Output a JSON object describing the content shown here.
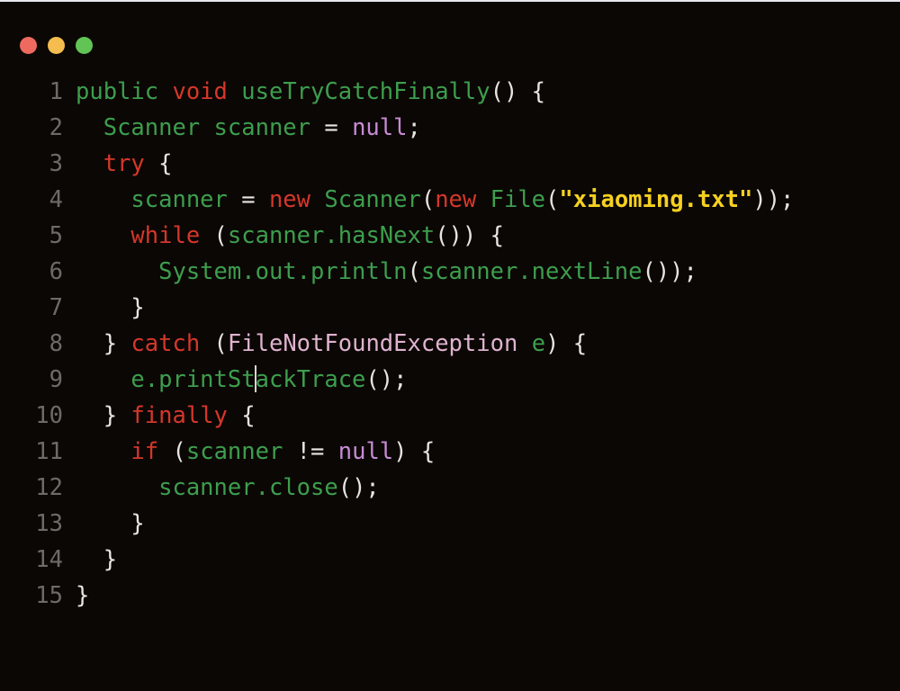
{
  "window": {
    "title_bar": {
      "buttons": [
        {
          "name": "close",
          "label": "Close",
          "color": "#ee6a5f"
        },
        {
          "name": "minimize",
          "label": "Minimize",
          "color": "#f5bd4f"
        },
        {
          "name": "maximize",
          "label": "Maximize",
          "color": "#61c454"
        }
      ]
    },
    "background": "#0b0705",
    "language": "java"
  },
  "theme": {
    "plain": "#e8e4e0",
    "keyword": "#d5372a",
    "identifier": "#3d9e4d",
    "type": "#dfb3cf",
    "constant": "#c88bd6",
    "string": "#f5d020",
    "punctuation": "#e8e4e0",
    "line_number": "#6f6a66",
    "caret": "#d8d4d0"
  },
  "editor": {
    "caret": {
      "line": 9,
      "column": 16
    },
    "line_numbers": [
      "1",
      "2",
      "3",
      "4",
      "5",
      "6",
      "7",
      "8",
      "9",
      "10",
      "11",
      "12",
      "13",
      "14",
      "15"
    ],
    "lines": [
      {
        "number": "1",
        "text": "public void useTryCatchFinally() {",
        "tokens": [
          {
            "t": "public",
            "c": "ident"
          },
          {
            "t": " ",
            "c": "plain"
          },
          {
            "t": "void",
            "c": "kw"
          },
          {
            "t": " ",
            "c": "plain"
          },
          {
            "t": "useTryCatchFinally",
            "c": "ident"
          },
          {
            "t": "() {",
            "c": "punct"
          }
        ]
      },
      {
        "number": "2",
        "text": "  Scanner scanner = null;",
        "tokens": [
          {
            "t": "  ",
            "c": "plain"
          },
          {
            "t": "Scanner scanner",
            "c": "ident"
          },
          {
            "t": " = ",
            "c": "punct"
          },
          {
            "t": "null",
            "c": "const"
          },
          {
            "t": ";",
            "c": "punct"
          }
        ]
      },
      {
        "number": "3",
        "text": "  try {",
        "tokens": [
          {
            "t": "  ",
            "c": "plain"
          },
          {
            "t": "try",
            "c": "kw"
          },
          {
            "t": " {",
            "c": "punct"
          }
        ]
      },
      {
        "number": "4",
        "text": "    scanner = new Scanner(new File(\"xiaoming.txt\"));",
        "tokens": [
          {
            "t": "    ",
            "c": "plain"
          },
          {
            "t": "scanner",
            "c": "ident"
          },
          {
            "t": " = ",
            "c": "punct"
          },
          {
            "t": "new",
            "c": "kw"
          },
          {
            "t": " ",
            "c": "plain"
          },
          {
            "t": "Scanner",
            "c": "ident"
          },
          {
            "t": "(",
            "c": "punct"
          },
          {
            "t": "new",
            "c": "kw"
          },
          {
            "t": " ",
            "c": "plain"
          },
          {
            "t": "File",
            "c": "ident"
          },
          {
            "t": "(",
            "c": "punct"
          },
          {
            "t": "\"xiaoming.txt\"",
            "c": "string"
          },
          {
            "t": "));",
            "c": "punct"
          }
        ]
      },
      {
        "number": "5",
        "text": "    while (scanner.hasNext()) {",
        "tokens": [
          {
            "t": "    ",
            "c": "plain"
          },
          {
            "t": "while",
            "c": "kw"
          },
          {
            "t": " (",
            "c": "punct"
          },
          {
            "t": "scanner",
            "c": "ident"
          },
          {
            "t": ".",
            "c": "ident"
          },
          {
            "t": "hasNext",
            "c": "ident"
          },
          {
            "t": "()) {",
            "c": "punct"
          }
        ]
      },
      {
        "number": "6",
        "text": "      System.out.println(scanner.nextLine());",
        "tokens": [
          {
            "t": "      ",
            "c": "plain"
          },
          {
            "t": "System.out.println",
            "c": "ident"
          },
          {
            "t": "(",
            "c": "punct"
          },
          {
            "t": "scanner.nextLine",
            "c": "ident"
          },
          {
            "t": "());",
            "c": "punct"
          }
        ]
      },
      {
        "number": "7",
        "text": "    }",
        "tokens": [
          {
            "t": "    ",
            "c": "plain"
          },
          {
            "t": "}",
            "c": "punct"
          }
        ]
      },
      {
        "number": "8",
        "text": "  } catch (FileNotFoundException e) {",
        "tokens": [
          {
            "t": "  ",
            "c": "plain"
          },
          {
            "t": "}",
            "c": "punct"
          },
          {
            "t": " ",
            "c": "plain"
          },
          {
            "t": "catch",
            "c": "kw"
          },
          {
            "t": " (",
            "c": "punct"
          },
          {
            "t": "FileNotFoundException",
            "c": "type"
          },
          {
            "t": " ",
            "c": "plain"
          },
          {
            "t": "e",
            "c": "ident"
          },
          {
            "t": ") {",
            "c": "punct"
          }
        ]
      },
      {
        "number": "9",
        "text": "    e.printStackTrace();",
        "caret_after": "    e.printSt",
        "tokens": [
          {
            "t": "    ",
            "c": "plain"
          },
          {
            "t": "e.printSt",
            "c": "ident"
          },
          {
            "t": "CARET",
            "c": "caret"
          },
          {
            "t": "ackTrace",
            "c": "ident"
          },
          {
            "t": "();",
            "c": "punct"
          }
        ]
      },
      {
        "number": "10",
        "text": "  } finally {",
        "tokens": [
          {
            "t": "  ",
            "c": "plain"
          },
          {
            "t": "}",
            "c": "punct"
          },
          {
            "t": " ",
            "c": "plain"
          },
          {
            "t": "finally",
            "c": "kw"
          },
          {
            "t": " {",
            "c": "punct"
          }
        ]
      },
      {
        "number": "11",
        "text": "    if (scanner != null) {",
        "tokens": [
          {
            "t": "    ",
            "c": "plain"
          },
          {
            "t": "if",
            "c": "kw"
          },
          {
            "t": " (",
            "c": "punct"
          },
          {
            "t": "scanner",
            "c": "ident"
          },
          {
            "t": " != ",
            "c": "punct"
          },
          {
            "t": "null",
            "c": "const"
          },
          {
            "t": ") {",
            "c": "punct"
          }
        ]
      },
      {
        "number": "12",
        "text": "      scanner.close();",
        "tokens": [
          {
            "t": "      ",
            "c": "plain"
          },
          {
            "t": "scanner.close",
            "c": "ident"
          },
          {
            "t": "();",
            "c": "punct"
          }
        ]
      },
      {
        "number": "13",
        "text": "    }",
        "tokens": [
          {
            "t": "    ",
            "c": "plain"
          },
          {
            "t": "}",
            "c": "punct"
          }
        ]
      },
      {
        "number": "14",
        "text": "  }",
        "tokens": [
          {
            "t": "  ",
            "c": "plain"
          },
          {
            "t": "}",
            "c": "punct"
          }
        ]
      },
      {
        "number": "15",
        "text": "}",
        "tokens": [
          {
            "t": "}",
            "c": "punct"
          }
        ]
      }
    ]
  }
}
